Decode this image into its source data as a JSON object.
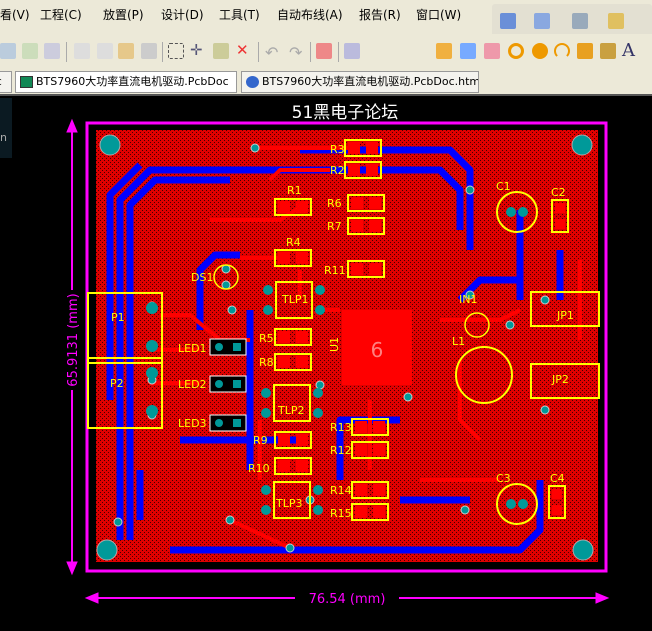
{
  "menu": [
    "看(V)",
    "工程(C)",
    "放置(P)",
    "设计(D)",
    "工具(T)",
    "自动布线(A)",
    "报告(R)",
    "窗口(W)"
  ],
  "tabs": [
    {
      "label": "oc"
    },
    {
      "label": "BTS7960大功率直流电机驱动.PcbDoc",
      "active": true
    },
    {
      "label": "BTS7960大功率直流电机驱动.PcbDoc.htm"
    }
  ],
  "left_panel_text": "n",
  "pcb": {
    "title": "51黑电子论坛",
    "width_dimension": "76.54 (mm)",
    "height_dimension": "65.9131 (mm)",
    "u1_pad_label": "6",
    "components": [
      "R3",
      "R2",
      "R1",
      "R6",
      "R7",
      "R4",
      "R11",
      "DS1",
      "TLP1",
      "P1",
      "P2",
      "LED1",
      "LED2",
      "LED3",
      "R5",
      "R8",
      "U1",
      "TLP2",
      "R9",
      "R10",
      "TLP3",
      "R13",
      "R12",
      "R14",
      "R15",
      "IN1",
      "L1",
      "C1",
      "C2",
      "JP1",
      "JP2",
      "C3",
      "C4"
    ],
    "colors": {
      "board_outline": "#ff00ff",
      "top_copper": "#ff0000",
      "bottom_copper": "#0000ff",
      "silkscreen": "#ffff00",
      "via": "#009999",
      "background": "#000000"
    }
  }
}
